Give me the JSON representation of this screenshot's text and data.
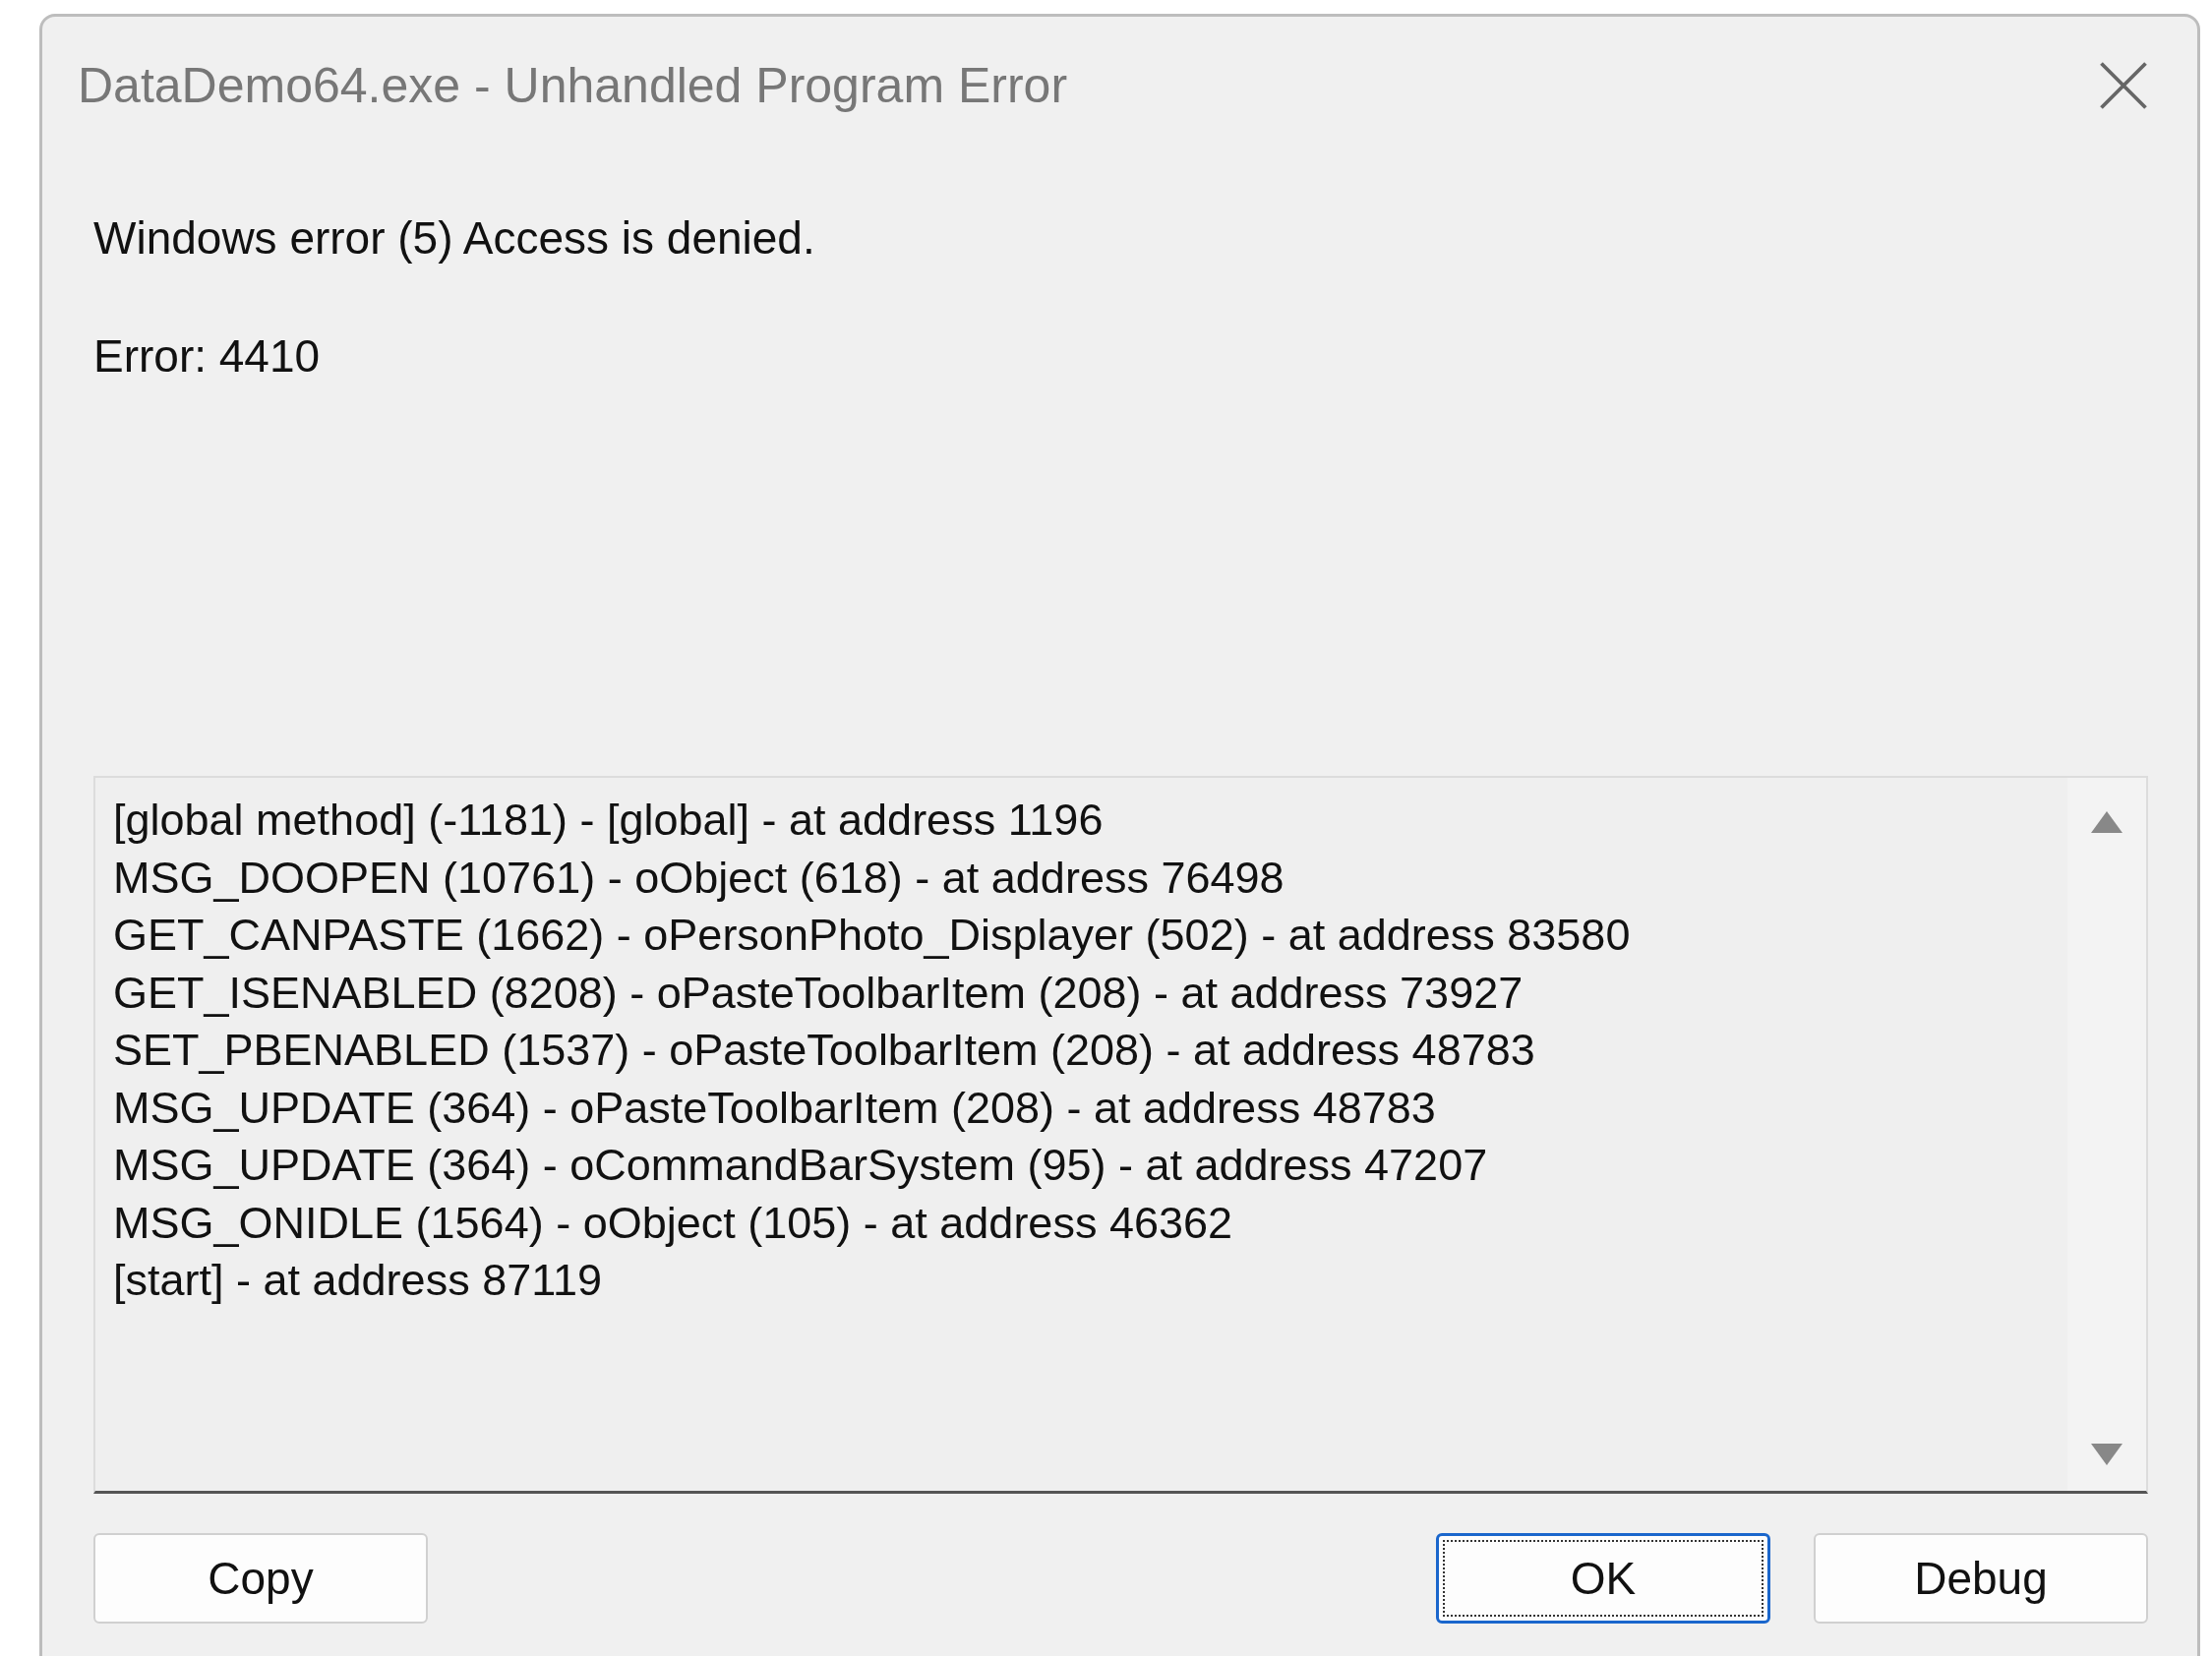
{
  "window": {
    "title": "DataDemo64.exe - Unhandled Program Error"
  },
  "messages": [
    "Windows error (5) Access is denied.",
    "Error: 4410"
  ],
  "call_stack": [
    "[global method] (-1181) - [global] - at address 1196",
    "MSG_DOOPEN (10761) - oObject (618) - at address 76498",
    "GET_CANPASTE (1662) - oPersonPhoto_Displayer (502) - at address 83580",
    "GET_ISENABLED (8208) - oPasteToolbarItem (208) - at address 73927",
    "SET_PBENABLED (1537) - oPasteToolbarItem (208) - at address 48783",
    "MSG_UPDATE (364) - oPasteToolbarItem (208) - at address 48783",
    "MSG_UPDATE (364) - oCommandBarSystem (95) - at address 47207",
    "MSG_ONIDLE (1564) - oObject (105) - at address 46362",
    "[start] - at address 87119"
  ],
  "buttons": [
    {
      "label": "Copy",
      "default": false
    },
    {
      "label": "OK",
      "default": true
    },
    {
      "label": "Debug",
      "default": false
    }
  ]
}
